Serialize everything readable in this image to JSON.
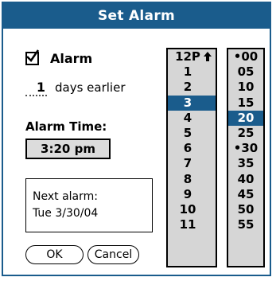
{
  "dialog": {
    "title": "Set Alarm",
    "alarm_checkbox": {
      "label": "Alarm",
      "checked": true
    },
    "days_earlier": {
      "value": "1",
      "label": "days earlier"
    },
    "alarm_time_label": "Alarm Time:",
    "alarm_time_value": "3:20 pm",
    "next_alarm": {
      "line1": "Next alarm:",
      "line2": "Tue 3/30/04"
    },
    "buttons": {
      "ok": "OK",
      "cancel": "Cancel"
    }
  },
  "hours": {
    "items": [
      "12P",
      "1",
      "2",
      "3",
      "4",
      "5",
      "6",
      "7",
      "8",
      "9",
      "10",
      "11"
    ],
    "selected_index": 3
  },
  "minutes": {
    "items": [
      "•00",
      "05",
      "10",
      "15",
      "20",
      "25",
      "•30",
      "35",
      "40",
      "45",
      "50",
      "55"
    ],
    "selected_index": 4
  },
  "colors": {
    "accent": "#1a5c8c",
    "column_bg": "#d6d6d6"
  }
}
